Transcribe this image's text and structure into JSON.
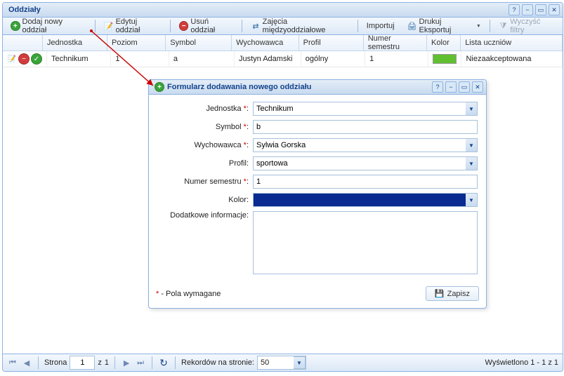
{
  "window": {
    "title": "Oddziały"
  },
  "toolbar": {
    "add": "Dodaj nowy oddział",
    "edit": "Edytuj oddział",
    "del": "Usuń oddział",
    "swap": "Zajęcia międzyoddziałowe",
    "import": "Importuj",
    "print_export": "Drukuj Eksportuj",
    "clear_filters": "Wyczyść filtry"
  },
  "grid": {
    "headers": {
      "jednostka": "Jednostka",
      "poziom": "Poziom",
      "symbol": "Symbol",
      "wychowawca": "Wychowawca",
      "profil": "Profil",
      "numer_semestru": "Numer semestru",
      "kolor": "Kolor",
      "lista": "Lista uczniów"
    },
    "rows": [
      {
        "jednostka": "Technikum",
        "poziom": "1",
        "symbol": "a",
        "wychowawca": "Justyn Adamski",
        "profil": "ogólny",
        "numer_semestru": "1",
        "kolor": "#60c030",
        "lista": "Niezaakceptowana"
      }
    ]
  },
  "dialog": {
    "title": "Formularz dodawania nowego oddziału",
    "labels": {
      "jednostka": "Jednostka",
      "symbol": "Symbol",
      "wychowawca": "Wychowawca",
      "profil": "Profil",
      "numer_semestru": "Numer semestru",
      "kolor": "Kolor",
      "dodatkowe": "Dodatkowe informacje"
    },
    "values": {
      "jednostka": "Technikum",
      "symbol": "b",
      "wychowawca": "Sylwia Gorska",
      "profil": "sportowa",
      "numer_semestru": "1",
      "kolor": "#0a2b90",
      "dodatkowe": ""
    },
    "note_mark": "*",
    "note_text": " - Pola wymagane",
    "save": "Zapisz"
  },
  "pager": {
    "page_label": "Strona",
    "page_of_sep": "z",
    "page_current": "1",
    "page_total": "1",
    "records_label": "Rekordów na stronie:",
    "records_value": "50",
    "summary": "Wyświetlono 1 - 1 z 1"
  }
}
